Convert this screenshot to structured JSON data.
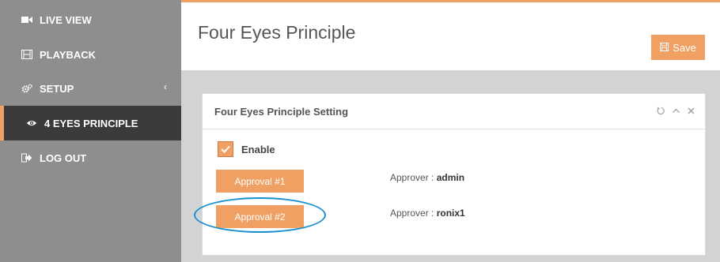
{
  "sidebar": {
    "items": [
      {
        "label": "LIVE VIEW",
        "icon": "video-camera-icon"
      },
      {
        "label": "PLAYBACK",
        "icon": "film-icon"
      },
      {
        "label": "SETUP",
        "icon": "gears-icon",
        "chevron": "‹"
      },
      {
        "label": "4 EYES PRINCIPLE",
        "icon": "eye-icon",
        "active": true
      },
      {
        "label": "LOG OUT",
        "icon": "logout-icon"
      }
    ]
  },
  "header": {
    "title": "Four Eyes Principle",
    "save_label": "Save"
  },
  "panel": {
    "title": "Four Eyes Principle Setting",
    "enable_label": "Enable",
    "enable_checked": true,
    "approvals": [
      {
        "button_label": "Approval #1",
        "approver_prefix": "Approver : ",
        "approver_name": "admin"
      },
      {
        "button_label": "Approval #2",
        "approver_prefix": "Approver : ",
        "approver_name": "ronix1"
      }
    ]
  },
  "colors": {
    "accent": "#f0a062",
    "sidebar": "#8e8e8e",
    "sidebar_active": "#3b3b3b",
    "highlight_ring": "#1a8fd1"
  }
}
